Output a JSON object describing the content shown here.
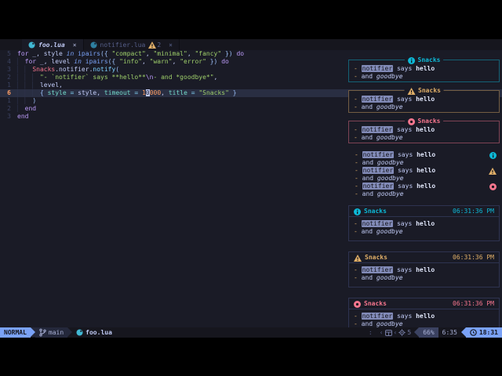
{
  "colors": {
    "bg": "#1a1b26",
    "bg_dark": "#16161e",
    "cursorline": "#292e42",
    "fg": "#c0caf5",
    "accent_blue": "#7aa2f7",
    "info": "#0db9d7",
    "warn": "#e0af68",
    "error": "#f7768e",
    "number_orange": "#ff9e64",
    "string_green": "#9ece6a",
    "keyword_purple": "#bb9af7"
  },
  "icons": {
    "close": "×",
    "chevron_left": "‹",
    "lua": "lua-logo",
    "info": "info-circle",
    "warn": "warning-triangle",
    "error": "error-circle",
    "branch": "git-branch",
    "clock": "clock",
    "moon": "lazy-moon",
    "gear": "gear",
    "grid": "window-grid"
  },
  "tabline": {
    "tabs": [
      {
        "label": "foo.lua",
        "active": true,
        "diag": ""
      },
      {
        "label": "notifier.lua",
        "active": false,
        "diag": "2"
      }
    ]
  },
  "editor": {
    "lines": [
      {
        "nr": "5",
        "current": false,
        "tokens": [
          [
            "kw",
            "for"
          ],
          [
            "var",
            " _, style "
          ],
          [
            "kwi",
            "in"
          ],
          [
            "var",
            " "
          ],
          [
            "fn",
            "ipairs"
          ],
          [
            "pu",
            "({ "
          ],
          [
            "str",
            "\"compact\""
          ],
          [
            "var",
            ", "
          ],
          [
            "str",
            "\"minimal\""
          ],
          [
            "var",
            ", "
          ],
          [
            "str",
            "\"fancy\""
          ],
          [
            "pu",
            " })"
          ],
          [
            "kw",
            " do"
          ]
        ]
      },
      {
        "nr": "4",
        "current": false,
        "tokens": [
          [
            "gd",
            "▏"
          ],
          [
            "var",
            " "
          ],
          [
            "kw",
            "for"
          ],
          [
            "var",
            " _, level "
          ],
          [
            "kwi",
            "in"
          ],
          [
            "var",
            " "
          ],
          [
            "fn",
            "ipairs"
          ],
          [
            "pu",
            "({ "
          ],
          [
            "str",
            "\"info\""
          ],
          [
            "var",
            ", "
          ],
          [
            "str",
            "\"warn\""
          ],
          [
            "var",
            ", "
          ],
          [
            "str",
            "\"error\""
          ],
          [
            "pu",
            " })"
          ],
          [
            "kw",
            " do"
          ]
        ]
      },
      {
        "nr": "3",
        "current": false,
        "tokens": [
          [
            "gd",
            "▏"
          ],
          [
            "var",
            " "
          ],
          [
            "gd",
            "▏"
          ],
          [
            "var",
            " "
          ],
          [
            "glob",
            "Snacks"
          ],
          [
            "var",
            ".notifier."
          ],
          [
            "meth",
            "notify"
          ],
          [
            "pu",
            "("
          ]
        ]
      },
      {
        "nr": "2",
        "current": false,
        "tokens": [
          [
            "gd",
            "▏"
          ],
          [
            "var",
            " "
          ],
          [
            "gd",
            "▏"
          ],
          [
            "var",
            " "
          ],
          [
            "gd",
            "▏"
          ],
          [
            "var",
            " "
          ],
          [
            "str",
            "\"- `notifier` says **hello**"
          ],
          [
            "esc",
            "\\n"
          ],
          [
            "str",
            "- and *goodbye*\""
          ],
          [
            "var",
            ","
          ]
        ]
      },
      {
        "nr": "1",
        "current": false,
        "tokens": [
          [
            "gd",
            "▏"
          ],
          [
            "var",
            " "
          ],
          [
            "gd",
            "▏"
          ],
          [
            "var",
            " "
          ],
          [
            "gd",
            "▏"
          ],
          [
            "var",
            " "
          ],
          [
            "var",
            "level,"
          ]
        ]
      },
      {
        "nr": "6",
        "current": true,
        "tokens": [
          [
            "gd",
            "▏"
          ],
          [
            "var",
            " "
          ],
          [
            "gd",
            "▏"
          ],
          [
            "var",
            " "
          ],
          [
            "gd",
            "▏"
          ],
          [
            "var",
            " "
          ],
          [
            "pu",
            "{ "
          ],
          [
            "fld",
            "style"
          ],
          [
            "op",
            " = "
          ],
          [
            "var",
            "style"
          ],
          [
            "var",
            ", "
          ],
          [
            "fld",
            "timeout"
          ],
          [
            "op",
            " = "
          ],
          [
            "num",
            "1"
          ],
          [
            "cur",
            "0"
          ],
          [
            "num",
            "000"
          ],
          [
            "var",
            ", "
          ],
          [
            "fld",
            "title"
          ],
          [
            "op",
            " = "
          ],
          [
            "str",
            "\"Snacks\""
          ],
          [
            "pu",
            " }"
          ]
        ]
      },
      {
        "nr": "1",
        "current": false,
        "tokens": [
          [
            "gd",
            "▏"
          ],
          [
            "var",
            " "
          ],
          [
            "gd",
            "▏"
          ],
          [
            "var",
            " "
          ],
          [
            "pu",
            ")"
          ]
        ]
      },
      {
        "nr": "2",
        "current": false,
        "tokens": [
          [
            "gd",
            "▏"
          ],
          [
            "var",
            " "
          ],
          [
            "kw",
            "end"
          ]
        ]
      },
      {
        "nr": "3",
        "current": false,
        "tokens": [
          [
            "kw",
            "end"
          ]
        ]
      }
    ]
  },
  "notifications": {
    "message": {
      "line1": [
        [
          "dash",
          "- "
        ],
        [
          "code",
          "notifier"
        ],
        [
          "plain",
          " says "
        ],
        [
          "bold",
          "hello"
        ]
      ],
      "line2": [
        [
          "dash",
          "- "
        ],
        [
          "plain",
          "and "
        ],
        [
          "italic",
          "goodbye"
        ]
      ]
    },
    "compact": [
      {
        "level": "info",
        "title": "Snacks"
      },
      {
        "level": "warn",
        "title": "Snacks"
      },
      {
        "level": "error",
        "title": "Snacks"
      }
    ],
    "minimal": [
      {
        "level": "info"
      },
      {
        "level": "warn"
      },
      {
        "level": "error"
      }
    ],
    "fancy": [
      {
        "level": "info",
        "title": "Snacks",
        "time": "06:31:36 PM"
      },
      {
        "level": "warn",
        "title": "Snacks",
        "time": "06:31:36 PM"
      },
      {
        "level": "error",
        "title": "Snacks",
        "time": "06:31:36 PM"
      }
    ]
  },
  "statusline": {
    "mode": "NORMAL",
    "branch": "main",
    "file": "foo.lua",
    "colon": ":",
    "chevron": "‹",
    "updates": "5",
    "progress": "66%",
    "location": "6:35",
    "clock": "18:31"
  }
}
